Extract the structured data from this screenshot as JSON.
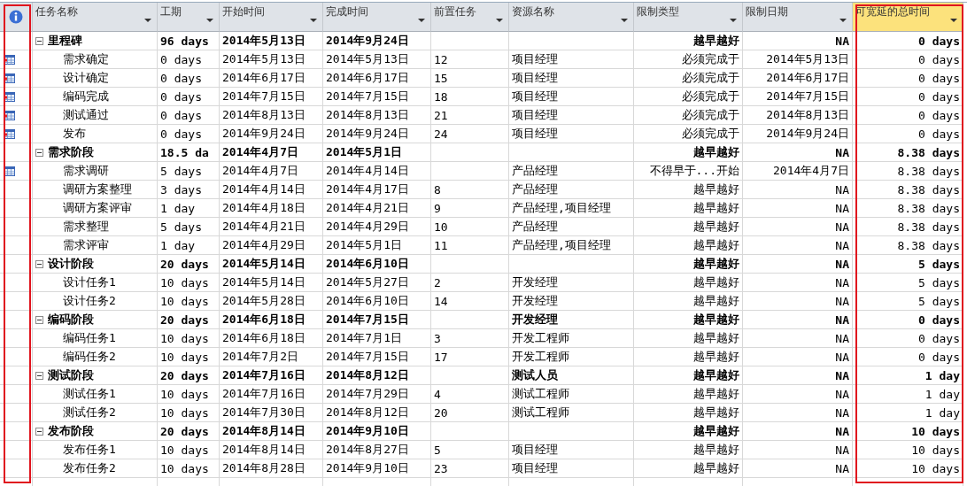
{
  "columns": [
    {
      "label": "任务名称",
      "selected": false
    },
    {
      "label": "工期",
      "selected": false
    },
    {
      "label": "开始时间",
      "selected": false
    },
    {
      "label": "完成时间",
      "selected": false
    },
    {
      "label": "前置任务",
      "selected": false
    },
    {
      "label": "资源名称",
      "selected": false
    },
    {
      "label": "限制类型",
      "selected": false
    },
    {
      "label": "限制日期",
      "selected": false
    },
    {
      "label": "可宽延的总时间",
      "selected": true
    }
  ],
  "groups": [
    {
      "cells": [
        "里程碑",
        "96 days",
        "2014年5月13日",
        "2014年9月24日",
        "",
        "",
        "越早越好",
        "NA",
        "0 days"
      ],
      "expanded": true,
      "children": [
        {
          "kind": "milestone",
          "cells": [
            "需求确定",
            "0 days",
            "2014年5月13日",
            "2014年5月13日",
            "12",
            "项目经理",
            "必须完成于",
            "2014年5月13日",
            "0 days"
          ]
        },
        {
          "kind": "milestone",
          "cells": [
            "设计确定",
            "0 days",
            "2014年6月17日",
            "2014年6月17日",
            "15",
            "项目经理",
            "必须完成于",
            "2014年6月17日",
            "0 days"
          ]
        },
        {
          "kind": "milestone",
          "cells": [
            "编码完成",
            "0 days",
            "2014年7月15日",
            "2014年7月15日",
            "18",
            "项目经理",
            "必须完成于",
            "2014年7月15日",
            "0 days"
          ]
        },
        {
          "kind": "milestone",
          "cells": [
            "测试通过",
            "0 days",
            "2014年8月13日",
            "2014年8月13日",
            "21",
            "项目经理",
            "必须完成于",
            "2014年8月13日",
            "0 days"
          ]
        },
        {
          "kind": "milestone",
          "cells": [
            "发布",
            "0 days",
            "2014年9月24日",
            "2014年9月24日",
            "24",
            "项目经理",
            "必须完成于",
            "2014年9月24日",
            "0 days"
          ]
        }
      ]
    },
    {
      "cells": [
        "需求阶段",
        "18.5 da",
        "2014年4月7日",
        "2014年5月1日",
        "",
        "",
        "越早越好",
        "NA",
        "8.38 days"
      ],
      "expanded": true,
      "children": [
        {
          "kind": "constrained",
          "cells": [
            "需求调研",
            "5 days",
            "2014年4月7日",
            "2014年4月14日",
            "",
            "产品经理",
            "不得早于...开始",
            "2014年4月7日",
            "8.38 days"
          ]
        },
        {
          "kind": "task",
          "cells": [
            "调研方案整理",
            "3 days",
            "2014年4月14日",
            "2014年4月17日",
            "8",
            "产品经理",
            "越早越好",
            "NA",
            "8.38 days"
          ]
        },
        {
          "kind": "task",
          "cells": [
            "调研方案评审",
            "1 day",
            "2014年4月18日",
            "2014年4月21日",
            "9",
            "产品经理,项目经理",
            "越早越好",
            "NA",
            "8.38 days"
          ]
        },
        {
          "kind": "task",
          "cells": [
            "需求整理",
            "5 days",
            "2014年4月21日",
            "2014年4月29日",
            "10",
            "产品经理",
            "越早越好",
            "NA",
            "8.38 days"
          ]
        },
        {
          "kind": "task",
          "cells": [
            "需求评审",
            "1 day",
            "2014年4月29日",
            "2014年5月1日",
            "11",
            "产品经理,项目经理",
            "越早越好",
            "NA",
            "8.38 days"
          ]
        }
      ]
    },
    {
      "cells": [
        "设计阶段",
        "20 days",
        "2014年5月14日",
        "2014年6月10日",
        "",
        "",
        "越早越好",
        "NA",
        "5 days"
      ],
      "expanded": true,
      "children": [
        {
          "kind": "task",
          "cells": [
            "设计任务1",
            "10 days",
            "2014年5月14日",
            "2014年5月27日",
            "2",
            "开发经理",
            "越早越好",
            "NA",
            "5 days"
          ]
        },
        {
          "kind": "task",
          "cells": [
            "设计任务2",
            "10 days",
            "2014年5月28日",
            "2014年6月10日",
            "14",
            "开发经理",
            "越早越好",
            "NA",
            "5 days"
          ]
        }
      ]
    },
    {
      "cells": [
        "编码阶段",
        "20 days",
        "2014年6月18日",
        "2014年7月15日",
        "",
        "开发经理",
        "越早越好",
        "NA",
        "0 days"
      ],
      "expanded": true,
      "children": [
        {
          "kind": "task",
          "cells": [
            "编码任务1",
            "10 days",
            "2014年6月18日",
            "2014年7月1日",
            "3",
            "开发工程师",
            "越早越好",
            "NA",
            "0 days"
          ]
        },
        {
          "kind": "task",
          "cells": [
            "编码任务2",
            "10 days",
            "2014年7月2日",
            "2014年7月15日",
            "17",
            "开发工程师",
            "越早越好",
            "NA",
            "0 days"
          ]
        }
      ]
    },
    {
      "cells": [
        "测试阶段",
        "20 days",
        "2014年7月16日",
        "2014年8月12日",
        "",
        "测试人员",
        "越早越好",
        "NA",
        "1 day"
      ],
      "expanded": true,
      "children": [
        {
          "kind": "task",
          "cells": [
            "测试任务1",
            "10 days",
            "2014年7月16日",
            "2014年7月29日",
            "4",
            "测试工程师",
            "越早越好",
            "NA",
            "1 day"
          ]
        },
        {
          "kind": "task",
          "cells": [
            "测试任务2",
            "10 days",
            "2014年7月30日",
            "2014年8月12日",
            "20",
            "测试工程师",
            "越早越好",
            "NA",
            "1 day"
          ]
        }
      ]
    },
    {
      "cells": [
        "发布阶段",
        "20 days",
        "2014年8月14日",
        "2014年9月10日",
        "",
        "",
        "越早越好",
        "NA",
        "10 days"
      ],
      "expanded": true,
      "children": [
        {
          "kind": "task",
          "cells": [
            "发布任务1",
            "10 days",
            "2014年8月14日",
            "2014年8月27日",
            "5",
            "项目经理",
            "越早越好",
            "NA",
            "10 days"
          ]
        },
        {
          "kind": "task",
          "cells": [
            "发布任务2",
            "10 days",
            "2014年8月28日",
            "2014年9月10日",
            "23",
            "项目经理",
            "越早越好",
            "NA",
            "10 days"
          ]
        }
      ]
    }
  ]
}
